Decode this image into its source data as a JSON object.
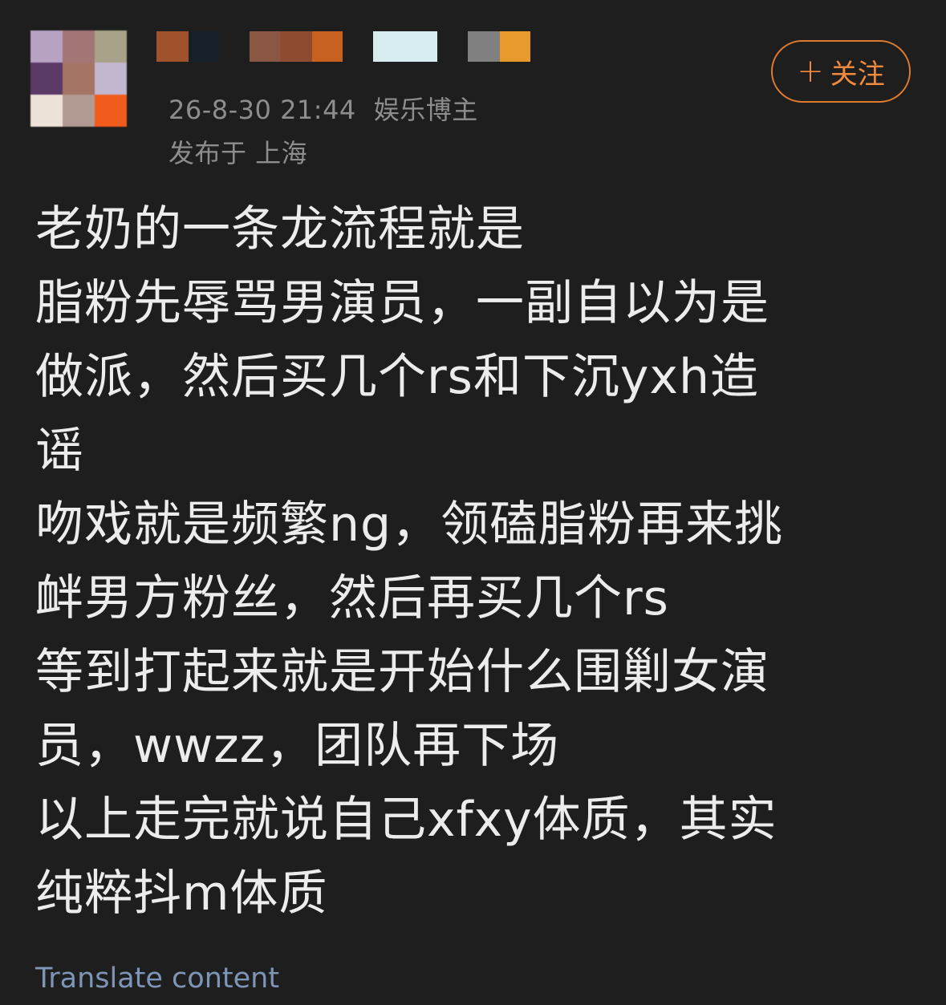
{
  "post": {
    "header": {
      "date": "26-8-30 21:44",
      "author_tag": "娱乐博主",
      "location": "发布于 上海",
      "follow_plus": "+",
      "follow_label": "关注"
    },
    "avatar_mosaic_colors": [
      "#b7a2c4",
      "#a37575",
      "#a8a388",
      "#5c3a68",
      "#a47565",
      "#c3b6cf",
      "#ece2d8",
      "#b19a92",
      "#ef5c1c"
    ],
    "username_mosaic_colors": [
      "#a0522d",
      "#15202b",
      "#1e1e1e",
      "#8a5744",
      "#8f4b2f",
      "#c8601f",
      "#1e1e1e",
      "#d6ecef",
      "#1e1e1e",
      "#808080",
      "#e89a2c"
    ],
    "content_lines": [
      "老奶的一条龙流程就是",
      "脂粉先辱骂男演员，一副自以为是",
      "做派，然后买几个rs和下沉yxh造",
      "谣",
      "吻戏就是频繁ng，领磕脂粉再来挑",
      "衅男方粉丝，然后再买几个rs",
      "等到打起来就是开始什么围剿女演",
      "员，wwzz，团队再下场",
      "以上走完就说自己xfxy体质，其实",
      "纯粹抖m体质"
    ],
    "translate_label": "Translate content",
    "accent_color": "#e07a2f",
    "link_color": "#7f95b8"
  }
}
